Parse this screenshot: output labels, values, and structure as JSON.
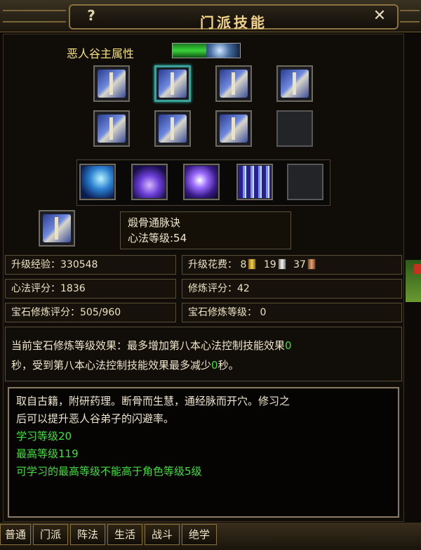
{
  "window": {
    "title": "门派技能",
    "help": "?",
    "close": "✕"
  },
  "main_attr": {
    "label": "恶人谷主属性"
  },
  "skill_books": [
    {
      "icon": "scroll-book-icon"
    },
    {
      "icon": "blue-book-icon",
      "selected": true
    },
    {
      "icon": "open-book-icon"
    },
    {
      "icon": "tome-icon"
    },
    {
      "icon": "open-book-icon"
    },
    {
      "icon": "closed-book-icon"
    },
    {
      "icon": "scroll-icon"
    },
    {
      "icon": "empty-slot"
    }
  ],
  "skills": [
    {
      "icon": "ice-dragon-skill-icon"
    },
    {
      "icon": "purple-wave-skill-icon"
    },
    {
      "icon": "lightning-burst-skill-icon"
    },
    {
      "icon": "light-pillar-skill-icon"
    },
    {
      "icon": "empty-slot"
    }
  ],
  "current": {
    "name": "煅骨通脉诀",
    "level_line": "心法等级:54"
  },
  "stats": {
    "exp": "升级经验：330548",
    "cost_label": "升级花费：",
    "cost_gold": "8",
    "cost_silver": "19",
    "cost_copper": "37",
    "xinfa_score": "心法评分：1836",
    "xiulian_score": "修炼评分：42",
    "gem_score": "宝石修炼评分：505/960",
    "gem_level": "宝石修炼等级： 0"
  },
  "effect": {
    "line1_a": "当前宝石修炼等级效果：最多增加第八本心法控制技能效果",
    "line1_val": "0",
    "line2_a": "秒，受到第八本心法控制技能效果最多减少",
    "line2_val": "0",
    "line2_b": "秒。"
  },
  "desc": {
    "text1": "取自古籍，附研药理。断骨而生慧，通经脉而开穴。修习之",
    "text2": "后可以提升恶人谷弟子的闪避率。",
    "learn_level": "学习等级20",
    "max_level": "最高等级119",
    "limit": "可学习的最高等级不能高于角色等级5级"
  },
  "tabs": [
    "普通",
    "门派",
    "阵法",
    "生活",
    "战斗",
    "绝学"
  ],
  "colors": {
    "title": "#f3d38a",
    "highlight": "#3ee03a",
    "label": "#f5e27a"
  }
}
